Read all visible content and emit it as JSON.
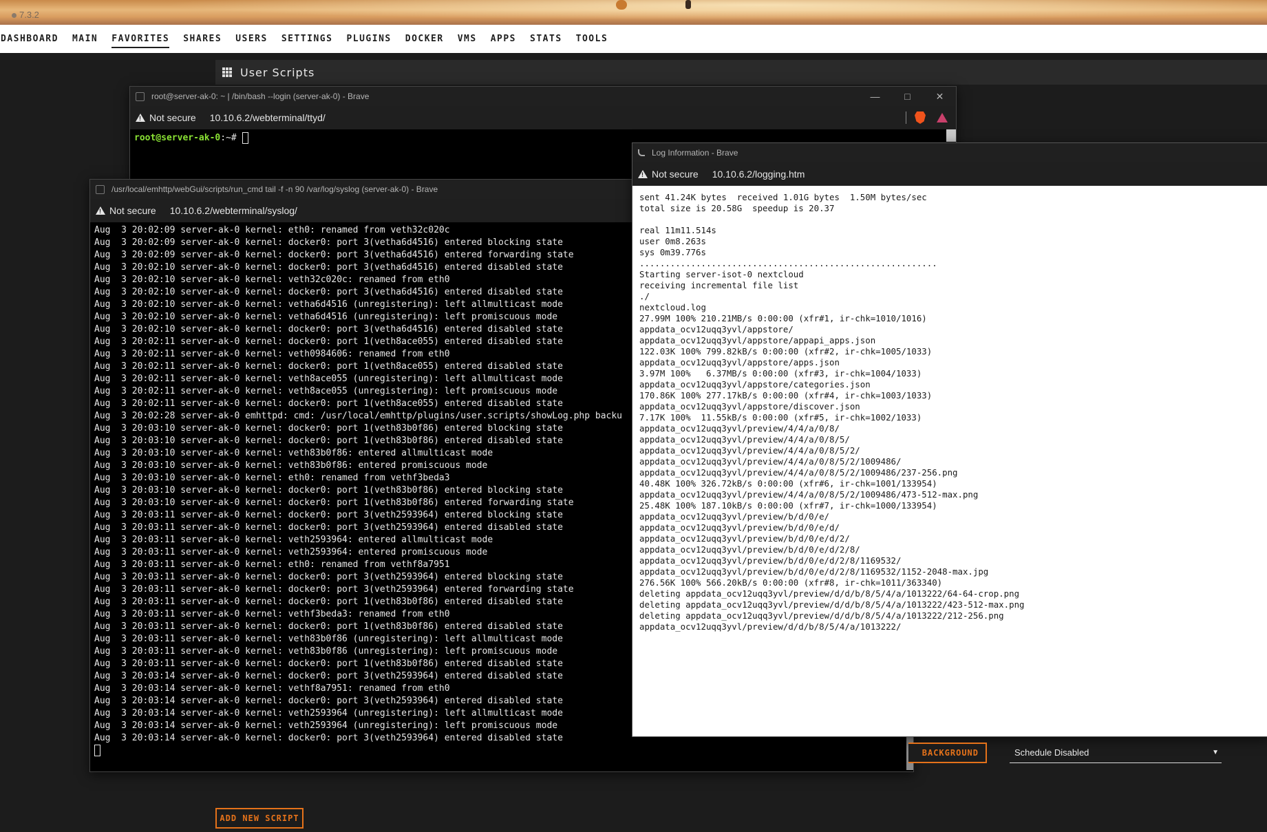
{
  "banner": {
    "version": "7.3.2"
  },
  "nav": {
    "items": [
      "DASHBOARD",
      "MAIN",
      "FAVORITES",
      "SHARES",
      "USERS",
      "SETTINGS",
      "PLUGINS",
      "DOCKER",
      "VMS",
      "APPS",
      "STATS",
      "TOOLS"
    ],
    "active": "FAVORITES"
  },
  "page": {
    "title": "User Scripts"
  },
  "bash_window": {
    "title": "root@server-ak-0: ~ | /bin/bash --login (server-ak-0) - Brave",
    "not_secure": "Not secure",
    "url": "10.10.6.2/webterminal/ttyd/",
    "prompt_user": "root@server-ak-0",
    "prompt_rest": ":~#"
  },
  "syslog_window": {
    "title": "/usr/local/emhttp/webGui/scripts/run_cmd tail -f -n 90 /var/log/syslog (server-ak-0) - Brave",
    "not_secure": "Not secure",
    "url": "10.10.6.2/webterminal/syslog/",
    "lines": [
      "Aug  3 20:02:09 server-ak-0 kernel: eth0: renamed from veth32c020c",
      "Aug  3 20:02:09 server-ak-0 kernel: docker0: port 3(vetha6d4516) entered blocking state",
      "Aug  3 20:02:09 server-ak-0 kernel: docker0: port 3(vetha6d4516) entered forwarding state",
      "Aug  3 20:02:10 server-ak-0 kernel: docker0: port 3(vetha6d4516) entered disabled state",
      "Aug  3 20:02:10 server-ak-0 kernel: veth32c020c: renamed from eth0",
      "Aug  3 20:02:10 server-ak-0 kernel: docker0: port 3(vetha6d4516) entered disabled state",
      "Aug  3 20:02:10 server-ak-0 kernel: vetha6d4516 (unregistering): left allmulticast mode",
      "Aug  3 20:02:10 server-ak-0 kernel: vetha6d4516 (unregistering): left promiscuous mode",
      "Aug  3 20:02:10 server-ak-0 kernel: docker0: port 3(vetha6d4516) entered disabled state",
      "Aug  3 20:02:11 server-ak-0 kernel: docker0: port 1(veth8ace055) entered disabled state",
      "Aug  3 20:02:11 server-ak-0 kernel: veth0984606: renamed from eth0",
      "Aug  3 20:02:11 server-ak-0 kernel: docker0: port 1(veth8ace055) entered disabled state",
      "Aug  3 20:02:11 server-ak-0 kernel: veth8ace055 (unregistering): left allmulticast mode",
      "Aug  3 20:02:11 server-ak-0 kernel: veth8ace055 (unregistering): left promiscuous mode",
      "Aug  3 20:02:11 server-ak-0 kernel: docker0: port 1(veth8ace055) entered disabled state",
      "Aug  3 20:02:28 server-ak-0 emhttpd: cmd: /usr/local/emhttp/plugins/user.scripts/showLog.php backu",
      "Aug  3 20:03:10 server-ak-0 kernel: docker0: port 1(veth83b0f86) entered blocking state",
      "Aug  3 20:03:10 server-ak-0 kernel: docker0: port 1(veth83b0f86) entered disabled state",
      "Aug  3 20:03:10 server-ak-0 kernel: veth83b0f86: entered allmulticast mode",
      "Aug  3 20:03:10 server-ak-0 kernel: veth83b0f86: entered promiscuous mode",
      "Aug  3 20:03:10 server-ak-0 kernel: eth0: renamed from vethf3beda3",
      "Aug  3 20:03:10 server-ak-0 kernel: docker0: port 1(veth83b0f86) entered blocking state",
      "Aug  3 20:03:10 server-ak-0 kernel: docker0: port 1(veth83b0f86) entered forwarding state",
      "Aug  3 20:03:11 server-ak-0 kernel: docker0: port 3(veth2593964) entered blocking state",
      "Aug  3 20:03:11 server-ak-0 kernel: docker0: port 3(veth2593964) entered disabled state",
      "Aug  3 20:03:11 server-ak-0 kernel: veth2593964: entered allmulticast mode",
      "Aug  3 20:03:11 server-ak-0 kernel: veth2593964: entered promiscuous mode",
      "Aug  3 20:03:11 server-ak-0 kernel: eth0: renamed from vethf8a7951",
      "Aug  3 20:03:11 server-ak-0 kernel: docker0: port 3(veth2593964) entered blocking state",
      "Aug  3 20:03:11 server-ak-0 kernel: docker0: port 3(veth2593964) entered forwarding state",
      "Aug  3 20:03:11 server-ak-0 kernel: docker0: port 1(veth83b0f86) entered disabled state",
      "Aug  3 20:03:11 server-ak-0 kernel: vethf3beda3: renamed from eth0",
      "Aug  3 20:03:11 server-ak-0 kernel: docker0: port 1(veth83b0f86) entered disabled state",
      "Aug  3 20:03:11 server-ak-0 kernel: veth83b0f86 (unregistering): left allmulticast mode",
      "Aug  3 20:03:11 server-ak-0 kernel: veth83b0f86 (unregistering): left promiscuous mode",
      "Aug  3 20:03:11 server-ak-0 kernel: docker0: port 1(veth83b0f86) entered disabled state",
      "Aug  3 20:03:14 server-ak-0 kernel: docker0: port 3(veth2593964) entered disabled state",
      "Aug  3 20:03:14 server-ak-0 kernel: vethf8a7951: renamed from eth0",
      "Aug  3 20:03:14 server-ak-0 kernel: docker0: port 3(veth2593964) entered disabled state",
      "Aug  3 20:03:14 server-ak-0 kernel: veth2593964 (unregistering): left allmulticast mode",
      "Aug  3 20:03:14 server-ak-0 kernel: veth2593964 (unregistering): left promiscuous mode",
      "Aug  3 20:03:14 server-ak-0 kernel: docker0: port 3(veth2593964) entered disabled state"
    ]
  },
  "log_window": {
    "title": "Log Information - Brave",
    "not_secure": "Not secure",
    "url": "10.10.6.2/logging.htm",
    "lines": [
      "sent 41.24K bytes  received 1.01G bytes  1.50M bytes/sec",
      "total size is 20.58G  speedup is 20.37",
      "",
      "real 11m11.514s",
      "user 0m8.263s",
      "sys 0m39.776s",
      "..........................................................",
      "Starting server-isot-0 nextcloud",
      "receiving incremental file list",
      "./",
      "nextcloud.log",
      "27.99M 100% 210.21MB/s 0:00:00 (xfr#1, ir-chk=1010/1016)",
      "appdata_ocv12uqq3yvl/appstore/",
      "appdata_ocv12uqq3yvl/appstore/appapi_apps.json",
      "122.03K 100% 799.82kB/s 0:00:00 (xfr#2, ir-chk=1005/1033)",
      "appdata_ocv12uqq3yvl/appstore/apps.json",
      "3.97M 100%   6.37MB/s 0:00:00 (xfr#3, ir-chk=1004/1033)",
      "appdata_ocv12uqq3yvl/appstore/categories.json",
      "170.86K 100% 277.17kB/s 0:00:00 (xfr#4, ir-chk=1003/1033)",
      "appdata_ocv12uqq3yvl/appstore/discover.json",
      "7.17K 100%  11.55kB/s 0:00:00 (xfr#5, ir-chk=1002/1033)",
      "appdata_ocv12uqq3yvl/preview/4/4/a/0/8/",
      "appdata_ocv12uqq3yvl/preview/4/4/a/0/8/5/",
      "appdata_ocv12uqq3yvl/preview/4/4/a/0/8/5/2/",
      "appdata_ocv12uqq3yvl/preview/4/4/a/0/8/5/2/1009486/",
      "appdata_ocv12uqq3yvl/preview/4/4/a/0/8/5/2/1009486/237-256.png",
      "40.48K 100% 326.72kB/s 0:00:00 (xfr#6, ir-chk=1001/133954)",
      "appdata_ocv12uqq3yvl/preview/4/4/a/0/8/5/2/1009486/473-512-max.png",
      "25.48K 100% 187.10kB/s 0:00:00 (xfr#7, ir-chk=1000/133954)",
      "appdata_ocv12uqq3yvl/preview/b/d/0/e/",
      "appdata_ocv12uqq3yvl/preview/b/d/0/e/d/",
      "appdata_ocv12uqq3yvl/preview/b/d/0/e/d/2/",
      "appdata_ocv12uqq3yvl/preview/b/d/0/e/d/2/8/",
      "appdata_ocv12uqq3yvl/preview/b/d/0/e/d/2/8/1169532/",
      "appdata_ocv12uqq3yvl/preview/b/d/0/e/d/2/8/1169532/1152-2048-max.jpg",
      "276.56K 100% 566.20kB/s 0:00:00 (xfr#8, ir-chk=1011/363340)",
      "deleting appdata_ocv12uqq3yvl/preview/d/d/b/8/5/4/a/1013222/64-64-crop.png",
      "deleting appdata_ocv12uqq3yvl/preview/d/d/b/8/5/4/a/1013222/423-512-max.png",
      "deleting appdata_ocv12uqq3yvl/preview/d/d/b/8/5/4/a/1013222/212-256.png",
      "appdata_ocv12uqq3yvl/preview/d/d/b/8/5/4/a/1013222/"
    ]
  },
  "bottom": {
    "background_button": "BACKGROUND",
    "schedule_select": "Schedule Disabled",
    "add_script_button": "ADD NEW SCRIPT"
  },
  "colors": {
    "accent": "#e5721a",
    "prompt_green": "#8ae234"
  }
}
